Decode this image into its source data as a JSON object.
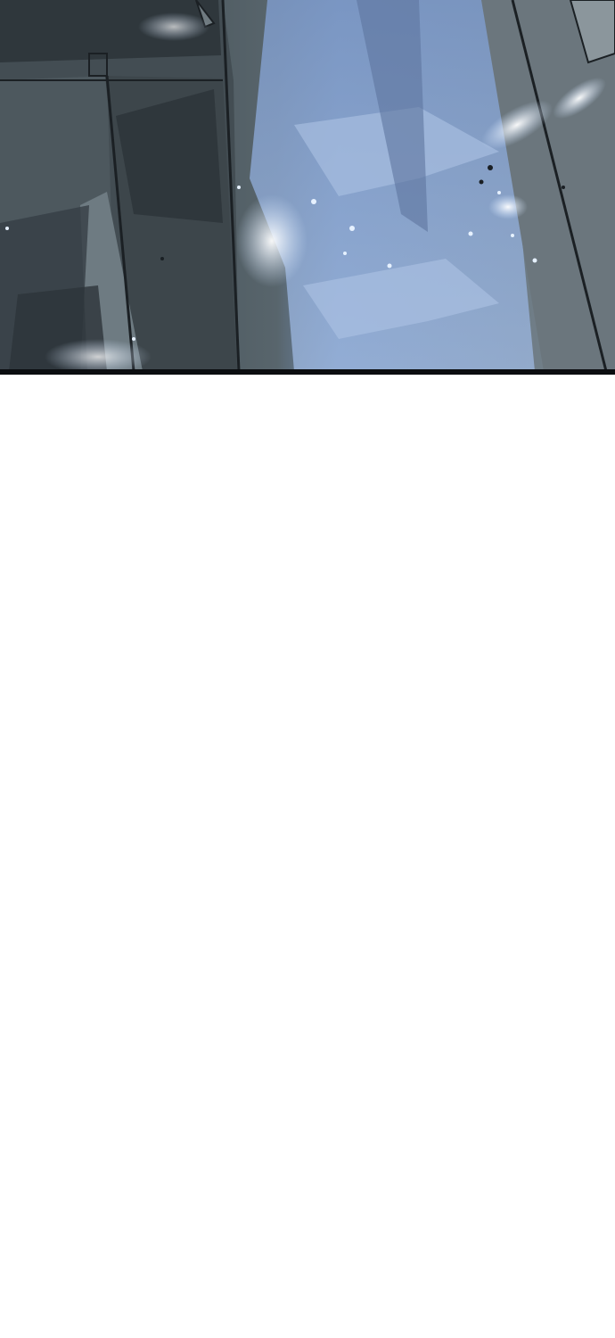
{
  "panels": [
    {
      "kind": "illustration",
      "description_icon": "comic-panel-icon",
      "colors": {
        "shadow": "#2b3339",
        "mid": "#5b6870",
        "cloth": "#4a5459",
        "glow": "#cfe3ff",
        "blue_mist": "#7d9ac6",
        "border": "#0b0d10"
      }
    }
  ],
  "blank_area": {
    "color": "#ffffff"
  }
}
